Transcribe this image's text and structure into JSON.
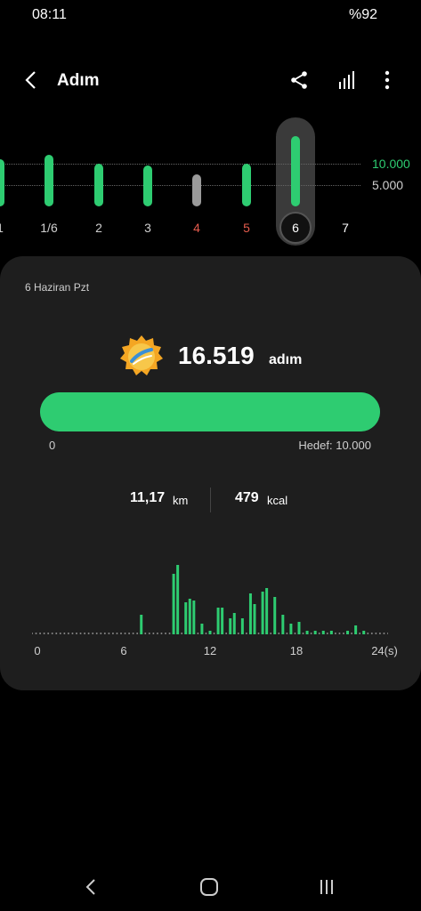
{
  "status_bar": {
    "time": "08:11",
    "battery": "%92"
  },
  "header": {
    "title": "Adım"
  },
  "week_chart": {
    "grid_labels": [
      "10.000",
      "5.000"
    ],
    "days": [
      {
        "label": "1",
        "steps": 11000,
        "color": "#2ecc71",
        "label_color": "#cfcfcf"
      },
      {
        "label": "1/6",
        "steps": 12000,
        "color": "#2ecc71",
        "label_color": "#cfcfcf"
      },
      {
        "label": "2",
        "steps": 10000,
        "color": "#2ecc71",
        "label_color": "#cfcfcf"
      },
      {
        "label": "3",
        "steps": 9500,
        "color": "#2ecc71",
        "label_color": "#cfcfcf"
      },
      {
        "label": "4",
        "steps": 7500,
        "color": "#9a9a9a",
        "label_color": "#e55b4d"
      },
      {
        "label": "5",
        "steps": 10000,
        "color": "#2ecc71",
        "label_color": "#e55b4d"
      },
      {
        "label": "6",
        "steps": 16519,
        "color": "#2ecc71",
        "label_color": "#ffffff",
        "selected": true
      },
      {
        "label": "7",
        "steps": 0,
        "color": "#2ecc71",
        "label_color": "#ffffff"
      }
    ]
  },
  "day_card": {
    "date": "6 Haziran Pzt",
    "steps": "16.519",
    "steps_unit": "adım",
    "progress": {
      "start_label": "0",
      "goal_label": "Hedef: 10.000",
      "fraction": 1.0,
      "color": "#2ecc71"
    },
    "distance_value": "11,17",
    "distance_unit": "km",
    "kcal_value": "479",
    "kcal_unit": "kcal"
  },
  "hourly_chart": {
    "x_labels": [
      "0",
      "6",
      "12",
      "18",
      "24(s)"
    ],
    "values": [
      0,
      0,
      0,
      0,
      0,
      0,
      0,
      0,
      0,
      0,
      0,
      0,
      0,
      0,
      0,
      0,
      0,
      0,
      0,
      0,
      0,
      0,
      0,
      0,
      0,
      0,
      0,
      22,
      0,
      0,
      0,
      0,
      0,
      0,
      0,
      68,
      78,
      0,
      36,
      40,
      38,
      0,
      12,
      0,
      4,
      0,
      30,
      30,
      0,
      18,
      24,
      0,
      18,
      0,
      46,
      34,
      0,
      48,
      52,
      0,
      42,
      0,
      22,
      0,
      12,
      0,
      14,
      0,
      4,
      0,
      4,
      0,
      4,
      0,
      4,
      0,
      0,
      0,
      4,
      0,
      10,
      0,
      4,
      0,
      0,
      0,
      0,
      0,
      0
    ],
    "color": "#2ecc71"
  }
}
